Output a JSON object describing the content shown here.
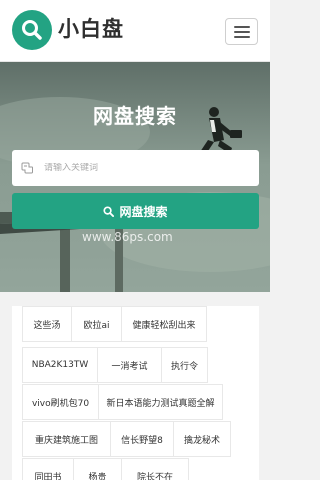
{
  "header": {
    "logo_text": "小白盘",
    "logo_icon": "search-icon",
    "menu_icon": "hamburger-icon"
  },
  "hero": {
    "title": "网盘搜索",
    "search_placeholder": "请输入关键词",
    "search_button_label": "网盘搜索",
    "watermark": "www.86ps.com"
  },
  "tags": [
    [
      "这些汤",
      "欧拉ai",
      "健康轻松刮出来"
    ],
    [
      "NBA2K13TW",
      "一消考试",
      "执行令"
    ],
    [
      "vivo刷机包70",
      "新日本语能力测试真题全解"
    ],
    [
      "重庆建筑施工图",
      "信长野望8",
      "擒龙秘术"
    ],
    [
      "同田书",
      "杨贵",
      "院长不在"
    ]
  ],
  "colors": {
    "accent": "#23a383",
    "header_bg": "#ffffff",
    "page_bg": "#f2f2f2"
  }
}
